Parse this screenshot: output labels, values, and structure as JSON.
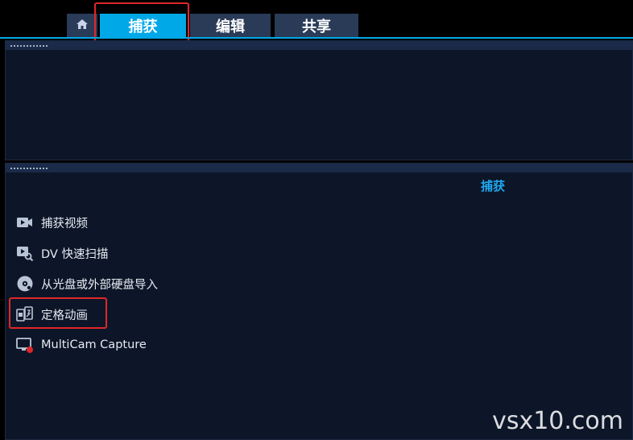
{
  "tabs": {
    "home": {
      "icon": "home-icon"
    },
    "capture": "捕获",
    "edit": "编辑",
    "share": "共享"
  },
  "library": {
    "section_title": "捕获",
    "items": [
      {
        "label": "捕获视频",
        "icon": "capture-video-icon"
      },
      {
        "label": "DV 快速扫描",
        "icon": "dv-scan-icon"
      },
      {
        "label": "从光盘或外部硬盘导入",
        "icon": "disc-import-icon"
      },
      {
        "label": "定格动画",
        "icon": "stop-motion-icon"
      },
      {
        "label": "MultiCam Capture",
        "icon": "multicam-capture-icon"
      }
    ]
  },
  "watermark": "vsx10.com",
  "colors": {
    "accent": "#00a8e8",
    "highlight": "#e0262a",
    "panel": "#0d1628",
    "tab": "#2a3b58"
  }
}
